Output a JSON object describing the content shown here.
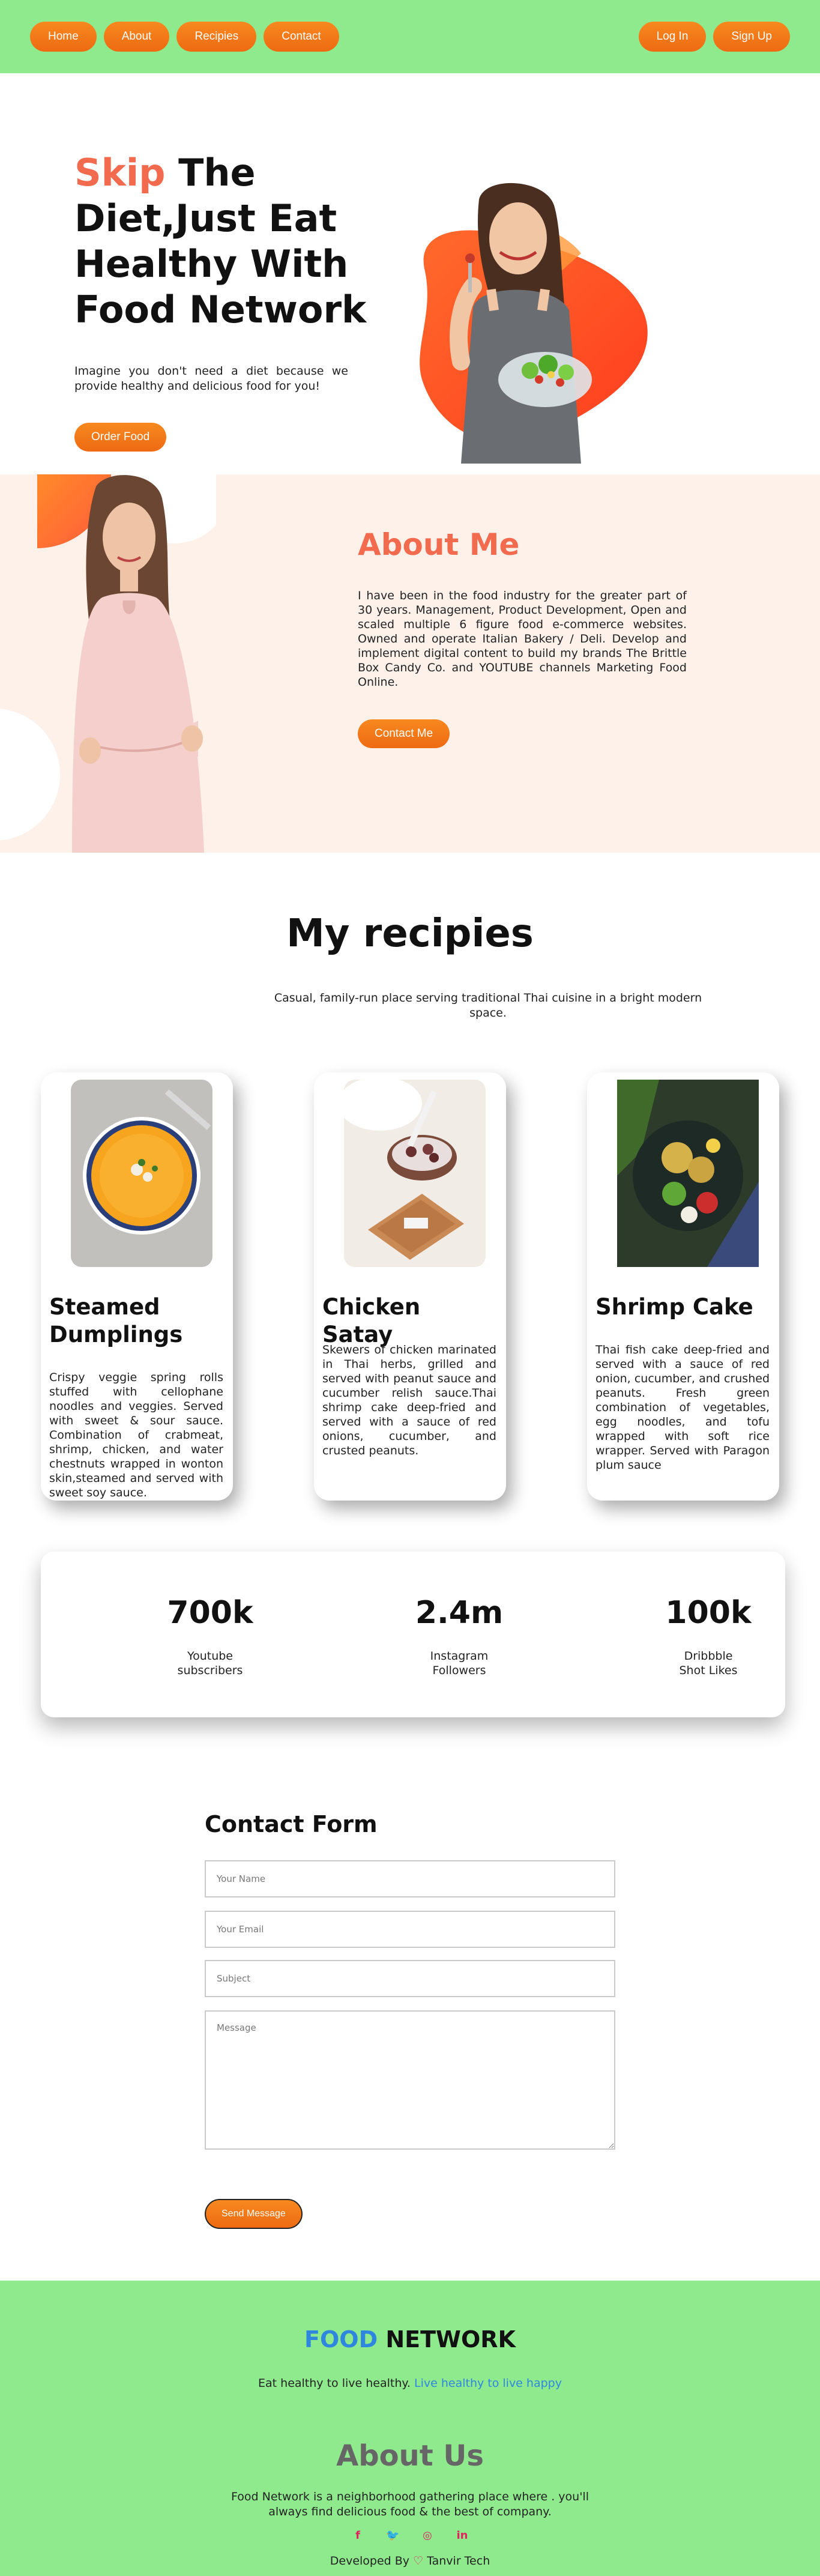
{
  "nav": {
    "left": [
      "Home",
      "About",
      "Recipies",
      "Contact"
    ],
    "login": "Log In",
    "signup": "Sign Up"
  },
  "hero": {
    "title_accent": "Skip",
    "title_rest": " The Diet,Just Eat Healthy With Food Network",
    "description": "Imagine you don't need a diet because we provide healthy and delicious food for you!",
    "cta": "Order Food"
  },
  "about": {
    "title": "About Me",
    "text": "I have been in the food industry for the greater part of 30 years. Management, Product Development, Open and scaled multiple 6 figure food e-commerce websites. Owned and operate Italian Bakery / Deli. Develop and implement digital content to build my brands The Brittle Box Candy Co. and YOUTUBE channels Marketing Food Online.",
    "cta": "Contact Me"
  },
  "recipes": {
    "title": "My recipies",
    "subtitle": "Casual, family-run place serving traditional Thai cuisine in a bright modern space.",
    "cards": [
      {
        "title": "Steamed Dumplings",
        "description": "Crispy veggie spring rolls stuffed with cellophane noodles and veggies. Served with sweet & sour sauce. Combination of crabmeat, shrimp, chicken, and water chestnuts wrapped in wonton skin,steamed and served with sweet soy sauce."
      },
      {
        "title": "Chicken Satay",
        "description": "Skewers of chicken marinated in Thai herbs, grilled and served with peanut sauce and cucumber relish sauce.Thai shrimp cake deep-fried and served with a sauce of red onions, cucumber, and crusted peanuts."
      },
      {
        "title": "Shrimp Cake",
        "description": "Thai fish cake deep-fried and served with a sauce of red onion, cucumber, and crushed peanuts. Fresh green combination of vegetables, egg noodles, and tofu wrapped with soft rice wrapper. Served with Paragon plum sauce"
      }
    ]
  },
  "stats": [
    {
      "value": "700k",
      "label": "Youtube\nsubscribers"
    },
    {
      "value": "2.4m",
      "label": "Instagram\nFollowers"
    },
    {
      "value": "100k",
      "label": "Dribbble\nShot Likes"
    }
  ],
  "contact": {
    "title": "Contact Form",
    "name_placeholder": "Your Name",
    "email_placeholder": "Your Email",
    "subject_placeholder": "Subject",
    "message_placeholder": "Message",
    "submit": "Send Message"
  },
  "footer": {
    "brand_part1": "FOOD",
    "brand_part2": " NETWORK",
    "tagline": "Eat healthy to live healthy. ",
    "tagline_link": "Live healthy to live happy",
    "about_title": "About Us",
    "about_text": "Food Network is a neighborhood gathering place where . you'll always find delicious food & the best of company.",
    "social_icons": [
      "facebook-icon",
      "twitter-icon",
      "instagram-icon",
      "linkedin-icon"
    ],
    "social_glyphs": [
      "f",
      "🐦",
      "◎",
      "in"
    ],
    "credit_prefix": "Developed By ",
    "credit_heart": "♡",
    "credit_name": " Tanvir Tech"
  },
  "colors": {
    "nav_green": "#8fea8d",
    "accent_orange": "#ee6a12",
    "accent_coral": "#f26b4f",
    "about_bg": "#fdf1ea",
    "link_blue": "#2e86de"
  }
}
